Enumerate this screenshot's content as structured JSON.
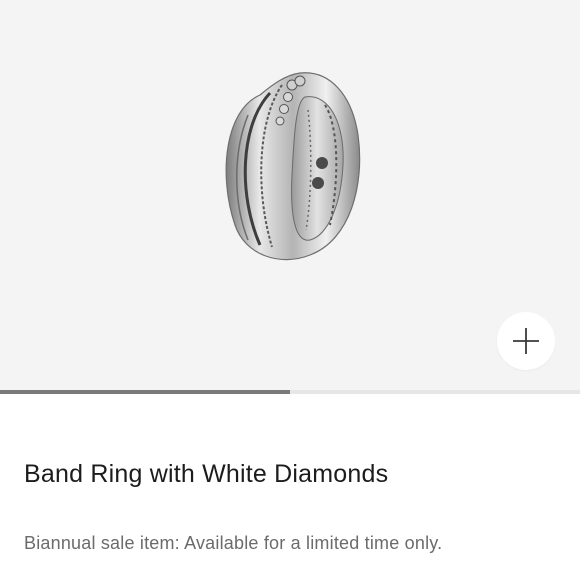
{
  "product": {
    "title": "Band Ring with White Diamonds",
    "sale_note": "Biannual sale item: Available for a limited time only."
  },
  "gallery": {
    "image_alt": "Band Ring with White Diamonds",
    "zoom_icon": "plus-icon",
    "progress": 0.5
  },
  "colors": {
    "gallery_bg": "#f4f4f4",
    "progress_fill": "#7a7a7a",
    "progress_track": "#e6e6e6"
  }
}
